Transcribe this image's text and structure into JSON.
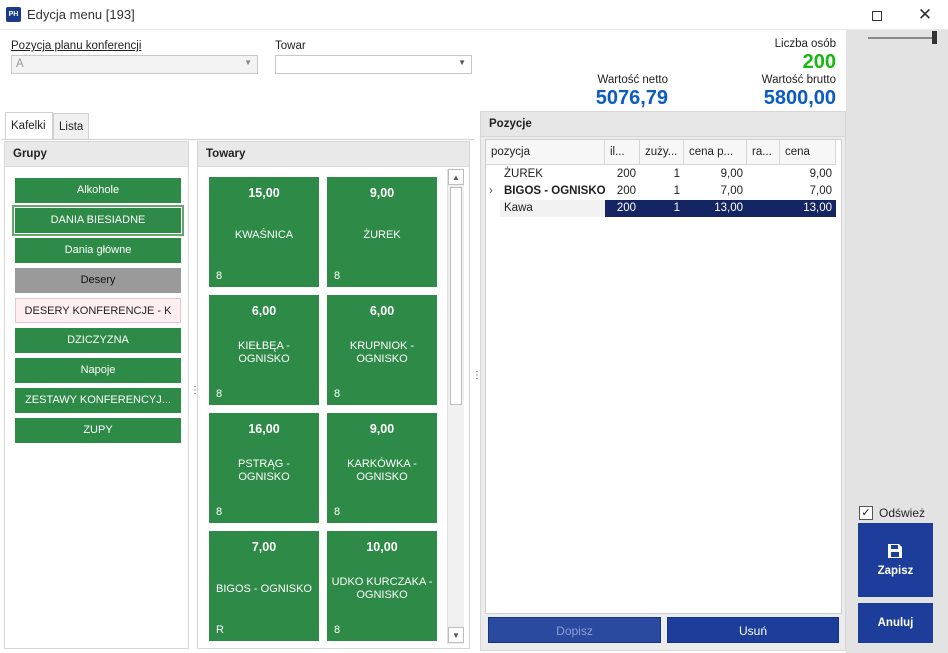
{
  "window": {
    "title": "Edycja menu [193]",
    "app_icon": "PH",
    "maximize_icon": "maximize-icon",
    "close_icon": "close-icon",
    "close_glyph": "✕"
  },
  "form": {
    "pozycja_label": "Pozycja planu konferencji",
    "pozycja_value": "A",
    "towar_label": "Towar",
    "towar_value": ""
  },
  "stats": {
    "liczba_label": "Liczba osób",
    "liczba_value": "200",
    "netto_label": "Wartość netto",
    "netto_value": "5076,79",
    "brutto_label": "Wartość brutto",
    "brutto_value": "5800,00",
    "liczba_color": "#17b80f",
    "value_color": "#0b5bc5"
  },
  "tabs": [
    {
      "label": "Kafelki",
      "active": true
    },
    {
      "label": "Lista",
      "active": false
    }
  ],
  "grupy": {
    "title": "Grupy",
    "items": [
      {
        "label": "Alkohole",
        "style": "green"
      },
      {
        "label": "DANIA BIESIADNE",
        "style": "selected"
      },
      {
        "label": "Dania główne",
        "style": "green"
      },
      {
        "label": "Desery",
        "style": "gray"
      },
      {
        "label": "DESERY KONFERENCJE - K",
        "style": "pink"
      },
      {
        "label": "DZICZYZNA",
        "style": "green"
      },
      {
        "label": "Napoje",
        "style": "green"
      },
      {
        "label": "ZESTAWY KONFERENCYJ...",
        "style": "green"
      },
      {
        "label": "ZUPY",
        "style": "green"
      }
    ]
  },
  "towary": {
    "title": "Towary",
    "tiles": [
      {
        "price": "15,00",
        "name": "KWAŚNICA",
        "code": "8"
      },
      {
        "price": "9,00",
        "name": "ŻUREK",
        "code": "8"
      },
      {
        "price": "6,00",
        "name": "KIEŁBĘA - OGNISKO",
        "code": "8"
      },
      {
        "price": "6,00",
        "name": "KRUPNIOK -OGNISKO",
        "code": "8"
      },
      {
        "price": "16,00",
        "name": "PSTRĄG - OGNISKO",
        "code": "8"
      },
      {
        "price": "9,00",
        "name": "KARKÓWKA - OGNISKO",
        "code": "8"
      },
      {
        "price": "7,00",
        "name": "BIGOS - OGNISKO",
        "code": "R"
      },
      {
        "price": "10,00",
        "name": "UDKO KURCZAKA - OGNISKO",
        "code": "8"
      }
    ],
    "scroll_up_icon": "▲",
    "scroll_down_icon": "▼"
  },
  "pozycje": {
    "title": "Pozycje",
    "columns": [
      "pozycja",
      "il...",
      "zuży...",
      "cena p...",
      "ra...",
      "cena"
    ],
    "rows": [
      {
        "pozycja": "ŻUREK",
        "il": "200",
        "zuzy": "1",
        "cena_p": "9,00",
        "ra": "",
        "cena": "9,00",
        "bold": false,
        "expand": ""
      },
      {
        "pozycja": "BIGOS - OGNISKO",
        "il": "200",
        "zuzy": "1",
        "cena_p": "7,00",
        "ra": "",
        "cena": "7,00",
        "bold": true,
        "expand": "›"
      },
      {
        "pozycja": "Kawa",
        "il": "200",
        "zuzy": "1",
        "cena_p": "13,00",
        "ra": "",
        "cena": "13,00",
        "bold": false,
        "expand": ""
      }
    ],
    "dopisz_label": "Dopisz",
    "usun_label": "Usuń"
  },
  "sidebar": {
    "odswiez_label": "Odśwież",
    "odswiez_checked": true,
    "check_glyph": "✓",
    "zapisz_label": "Zapisz",
    "zapisz_icon": "save-icon",
    "anuluj_label": "Anuluj"
  }
}
